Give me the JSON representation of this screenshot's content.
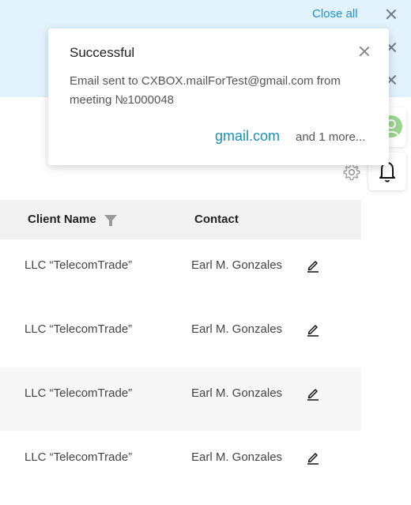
{
  "notifications": {
    "close_all_label": "Close all"
  },
  "popup": {
    "title": "Successful",
    "message": "Email sent to CXBOX.mailForTest@gmail.com from meeting №1000048",
    "link_label": "gmail.com",
    "more_label": "and 1 more..."
  },
  "table": {
    "columns": [
      "Client Name",
      "Contact"
    ],
    "rows": [
      {
        "client": "LLC “TelecomTrade”",
        "contact": "Earl M. Gonzales"
      },
      {
        "client": "LLC “TelecomTrade”",
        "contact": "Earl M. Gonzales"
      },
      {
        "client": "LLC “TelecomTrade”",
        "contact": "Earl M. Gonzales"
      },
      {
        "client": "LLC “TelecomTrade”",
        "contact": "Earl M. Gonzales"
      }
    ]
  },
  "icons": {
    "filter": "filter-icon",
    "edit": "pencil-icon",
    "settings": "gear-icon",
    "notifications": "bell-icon",
    "close": "close-icon",
    "avatar": "user-avatar"
  },
  "colors": {
    "notif_bg": "#e3f3fd",
    "link": "#1a90b8",
    "close_all": "#1a90d0",
    "avatar": "#9cd38e"
  }
}
